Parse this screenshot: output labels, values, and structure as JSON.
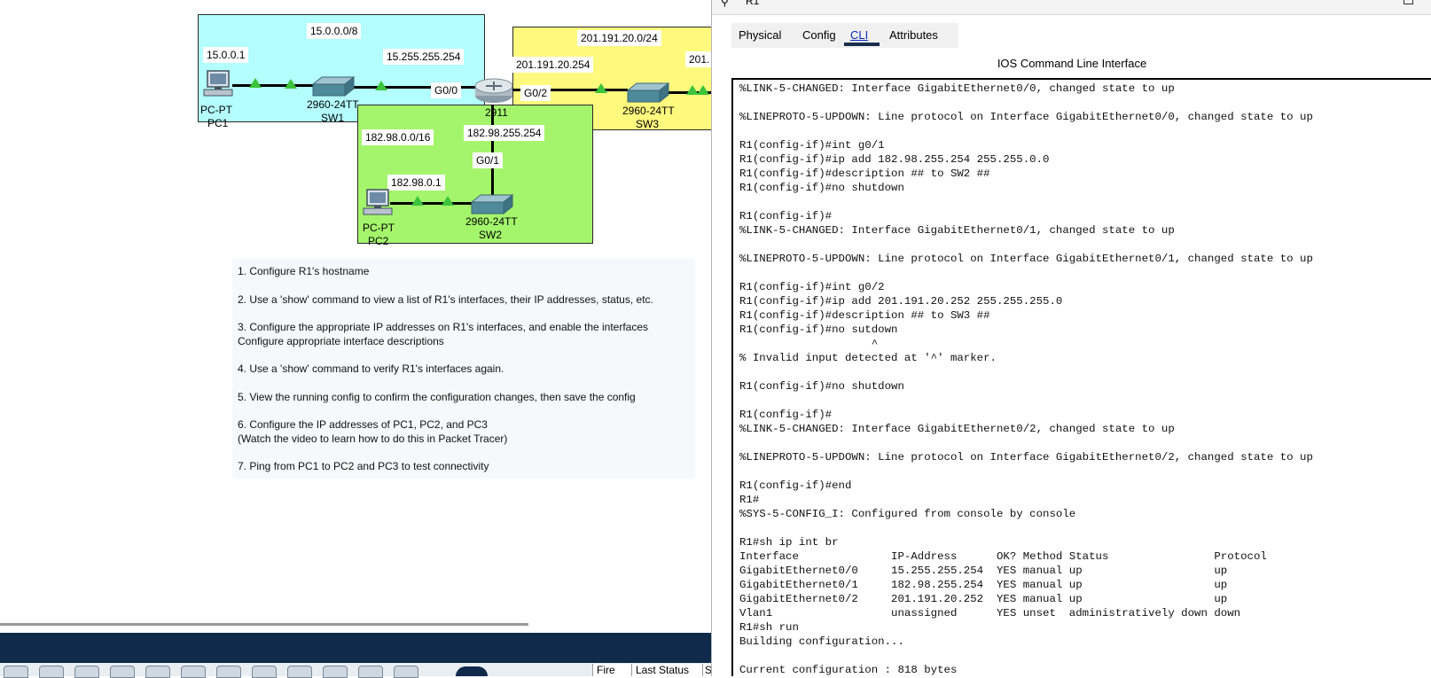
{
  "topology": {
    "networks": {
      "net1": "15.0.0.0/8",
      "net2": "182.98.0.0/16",
      "net3": "201.191.20.0/24"
    },
    "ip_labels": {
      "pc1_ip": "15.0.0.1",
      "r1_g00_ip": "15.255.255.254",
      "r1_g01_ip": "182.98.255.254",
      "r1_g02_ip": "201.191.20.254",
      "pc2_ip": "182.98.0.1",
      "sw3_partial": "201."
    },
    "ports": {
      "g00": "G0/0",
      "g01": "G0/1",
      "g02": "G0/2"
    },
    "devices": {
      "pc1_model": "PC-PT",
      "pc1_name": "PC1",
      "sw1_model": "2960-24TT",
      "sw1_name": "SW1",
      "r1_model": "2911",
      "sw3_model": "2960-24TT",
      "sw3_name": "SW3",
      "pc2_model": "PC-PT",
      "pc2_name": "PC2",
      "sw2_model": "2960-24TT",
      "sw2_name": "SW2"
    },
    "colors": {
      "zone1": "#b4feff",
      "zone2": "#a4f56c",
      "zone3": "#fff97e",
      "link_up": "#3cc43c"
    }
  },
  "tasks": [
    "1. Configure R1's hostname",
    "2. Use a 'show' command to view a list of R1's interfaces, their IP addresses, status, etc.",
    "3. Configure the appropriate IP addresses on R1's interfaces, and enable the interfaces",
    "    Configure appropriate interface descriptions",
    "4. Use a 'show' command to verify R1's interfaces again.",
    "5. View the running config to confirm the configuration changes, then save the config",
    "6. Configure the IP addresses of PC1, PC2, and PC3",
    "   (Watch the video to learn how to do this in Packet Tracer)",
    "7. Ping from PC1 to PC2 and PC3 to test connectivity"
  ],
  "dock": {
    "col_fire": "Fire",
    "col_last_status": "Last Status",
    "col_s": "S"
  },
  "r1_window": {
    "title": "R1",
    "tabs": [
      "Physical",
      "Config",
      "CLI",
      "Attributes"
    ],
    "active_tab": "CLI",
    "heading": "IOS Command Line Interface",
    "console_lines": [
      "%LINK-5-CHANGED: Interface GigabitEthernet0/0, changed state to up",
      "",
      "%LINEPROTO-5-UPDOWN: Line protocol on Interface GigabitEthernet0/0, changed state to up",
      "",
      "R1(config-if)#int g0/1",
      "R1(config-if)#ip add 182.98.255.254 255.255.0.0",
      "R1(config-if)#description ## to SW2 ##",
      "R1(config-if)#no shutdown",
      "",
      "R1(config-if)#",
      "%LINK-5-CHANGED: Interface GigabitEthernet0/1, changed state to up",
      "",
      "%LINEPROTO-5-UPDOWN: Line protocol on Interface GigabitEthernet0/1, changed state to up",
      "",
      "R1(config-if)#int g0/2",
      "R1(config-if)#ip add 201.191.20.252 255.255.255.0",
      "R1(config-if)#description ## to SW3 ##",
      "R1(config-if)#no sutdown",
      "                    ^",
      "% Invalid input detected at '^' marker.",
      "",
      "R1(config-if)#no shutdown",
      "",
      "R1(config-if)#",
      "%LINK-5-CHANGED: Interface GigabitEthernet0/2, changed state to up",
      "",
      "%LINEPROTO-5-UPDOWN: Line protocol on Interface GigabitEthernet0/2, changed state to up",
      "",
      "R1(config-if)#end",
      "R1#",
      "%SYS-5-CONFIG_I: Configured from console by console",
      "",
      "R1#sh ip int br",
      "Interface              IP-Address      OK? Method Status                Protocol",
      "GigabitEthernet0/0     15.255.255.254  YES manual up                    up",
      "GigabitEthernet0/1     182.98.255.254  YES manual up                    up",
      "GigabitEthernet0/2     201.191.20.252  YES manual up                    up",
      "Vlan1                  unassigned      YES unset  administratively down down",
      "R1#sh run",
      "Building configuration...",
      "",
      "Current configuration : 818 bytes"
    ]
  }
}
